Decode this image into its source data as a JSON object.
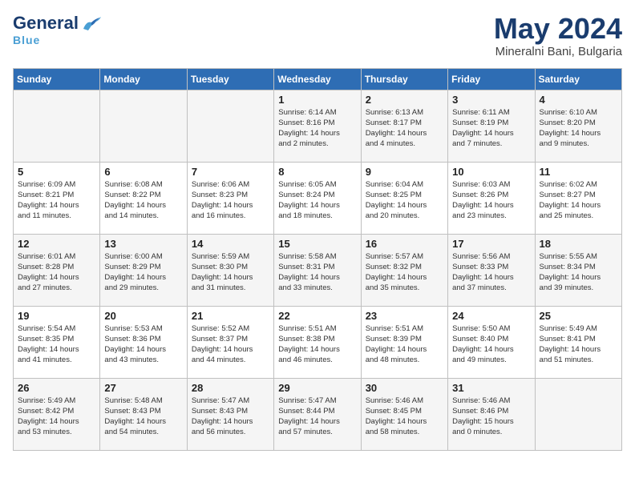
{
  "logo": {
    "line1": "General",
    "line2": "Blue",
    "bird": "🔵"
  },
  "title": {
    "month_year": "May 2024",
    "location": "Mineralni Bani, Bulgaria"
  },
  "days_of_week": [
    "Sunday",
    "Monday",
    "Tuesday",
    "Wednesday",
    "Thursday",
    "Friday",
    "Saturday"
  ],
  "weeks": [
    [
      {
        "day": "",
        "info": ""
      },
      {
        "day": "",
        "info": ""
      },
      {
        "day": "",
        "info": ""
      },
      {
        "day": "1",
        "info": "Sunrise: 6:14 AM\nSunset: 8:16 PM\nDaylight: 14 hours\nand 2 minutes."
      },
      {
        "day": "2",
        "info": "Sunrise: 6:13 AM\nSunset: 8:17 PM\nDaylight: 14 hours\nand 4 minutes."
      },
      {
        "day": "3",
        "info": "Sunrise: 6:11 AM\nSunset: 8:19 PM\nDaylight: 14 hours\nand 7 minutes."
      },
      {
        "day": "4",
        "info": "Sunrise: 6:10 AM\nSunset: 8:20 PM\nDaylight: 14 hours\nand 9 minutes."
      }
    ],
    [
      {
        "day": "5",
        "info": "Sunrise: 6:09 AM\nSunset: 8:21 PM\nDaylight: 14 hours\nand 11 minutes."
      },
      {
        "day": "6",
        "info": "Sunrise: 6:08 AM\nSunset: 8:22 PM\nDaylight: 14 hours\nand 14 minutes."
      },
      {
        "day": "7",
        "info": "Sunrise: 6:06 AM\nSunset: 8:23 PM\nDaylight: 14 hours\nand 16 minutes."
      },
      {
        "day": "8",
        "info": "Sunrise: 6:05 AM\nSunset: 8:24 PM\nDaylight: 14 hours\nand 18 minutes."
      },
      {
        "day": "9",
        "info": "Sunrise: 6:04 AM\nSunset: 8:25 PM\nDaylight: 14 hours\nand 20 minutes."
      },
      {
        "day": "10",
        "info": "Sunrise: 6:03 AM\nSunset: 8:26 PM\nDaylight: 14 hours\nand 23 minutes."
      },
      {
        "day": "11",
        "info": "Sunrise: 6:02 AM\nSunset: 8:27 PM\nDaylight: 14 hours\nand 25 minutes."
      }
    ],
    [
      {
        "day": "12",
        "info": "Sunrise: 6:01 AM\nSunset: 8:28 PM\nDaylight: 14 hours\nand 27 minutes."
      },
      {
        "day": "13",
        "info": "Sunrise: 6:00 AM\nSunset: 8:29 PM\nDaylight: 14 hours\nand 29 minutes."
      },
      {
        "day": "14",
        "info": "Sunrise: 5:59 AM\nSunset: 8:30 PM\nDaylight: 14 hours\nand 31 minutes."
      },
      {
        "day": "15",
        "info": "Sunrise: 5:58 AM\nSunset: 8:31 PM\nDaylight: 14 hours\nand 33 minutes."
      },
      {
        "day": "16",
        "info": "Sunrise: 5:57 AM\nSunset: 8:32 PM\nDaylight: 14 hours\nand 35 minutes."
      },
      {
        "day": "17",
        "info": "Sunrise: 5:56 AM\nSunset: 8:33 PM\nDaylight: 14 hours\nand 37 minutes."
      },
      {
        "day": "18",
        "info": "Sunrise: 5:55 AM\nSunset: 8:34 PM\nDaylight: 14 hours\nand 39 minutes."
      }
    ],
    [
      {
        "day": "19",
        "info": "Sunrise: 5:54 AM\nSunset: 8:35 PM\nDaylight: 14 hours\nand 41 minutes."
      },
      {
        "day": "20",
        "info": "Sunrise: 5:53 AM\nSunset: 8:36 PM\nDaylight: 14 hours\nand 43 minutes."
      },
      {
        "day": "21",
        "info": "Sunrise: 5:52 AM\nSunset: 8:37 PM\nDaylight: 14 hours\nand 44 minutes."
      },
      {
        "day": "22",
        "info": "Sunrise: 5:51 AM\nSunset: 8:38 PM\nDaylight: 14 hours\nand 46 minutes."
      },
      {
        "day": "23",
        "info": "Sunrise: 5:51 AM\nSunset: 8:39 PM\nDaylight: 14 hours\nand 48 minutes."
      },
      {
        "day": "24",
        "info": "Sunrise: 5:50 AM\nSunset: 8:40 PM\nDaylight: 14 hours\nand 49 minutes."
      },
      {
        "day": "25",
        "info": "Sunrise: 5:49 AM\nSunset: 8:41 PM\nDaylight: 14 hours\nand 51 minutes."
      }
    ],
    [
      {
        "day": "26",
        "info": "Sunrise: 5:49 AM\nSunset: 8:42 PM\nDaylight: 14 hours\nand 53 minutes."
      },
      {
        "day": "27",
        "info": "Sunrise: 5:48 AM\nSunset: 8:43 PM\nDaylight: 14 hours\nand 54 minutes."
      },
      {
        "day": "28",
        "info": "Sunrise: 5:47 AM\nSunset: 8:43 PM\nDaylight: 14 hours\nand 56 minutes."
      },
      {
        "day": "29",
        "info": "Sunrise: 5:47 AM\nSunset: 8:44 PM\nDaylight: 14 hours\nand 57 minutes."
      },
      {
        "day": "30",
        "info": "Sunrise: 5:46 AM\nSunset: 8:45 PM\nDaylight: 14 hours\nand 58 minutes."
      },
      {
        "day": "31",
        "info": "Sunrise: 5:46 AM\nSunset: 8:46 PM\nDaylight: 15 hours\nand 0 minutes."
      },
      {
        "day": "",
        "info": ""
      }
    ]
  ]
}
